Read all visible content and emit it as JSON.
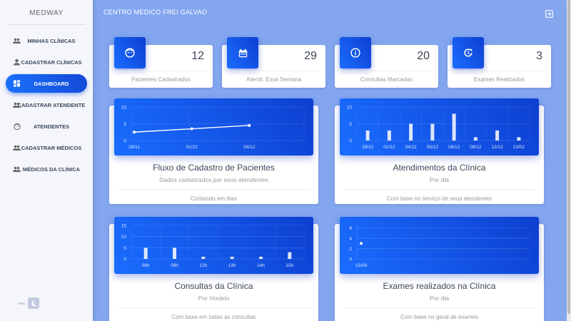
{
  "sidebar": {
    "brand": "MEDWAY",
    "items": [
      {
        "label": "MINHAS CLÍNICAS",
        "icon": "people-icon"
      },
      {
        "label": "CADASTRAR CLÍNICAS",
        "icon": "person-icon"
      },
      {
        "label": "DASHBOARD",
        "icon": "dashboard-icon",
        "active": true
      },
      {
        "label": "CADASTRAR ATENDENTE",
        "icon": "people-icon"
      },
      {
        "label": "ATENDENTES",
        "icon": "face-icon"
      },
      {
        "label": "CADASTRAR MÉDICOS",
        "icon": "people-icon"
      },
      {
        "label": "MÉDICOS DA CLÍNICA",
        "icon": "people-icon"
      }
    ]
  },
  "header": {
    "title": "CENTRO MEDICO FREI GALVAO",
    "logout_icon": "logout-icon"
  },
  "stats": [
    {
      "value": "12",
      "label": "Pacientes Cadastrados",
      "icon": "face-icon"
    },
    {
      "value": "29",
      "label": "Atendi. Essa Semana",
      "icon": "calendar-icon"
    },
    {
      "value": "20",
      "label": "Consultas Marcadas",
      "icon": "info-icon"
    },
    {
      "value": "3",
      "label": "Exames Realizados",
      "icon": "update-icon"
    }
  ],
  "cards": [
    {
      "title": "Fluxo de Cadastro de Pacientes",
      "subtitle": "Dados cadastrados por seus atendentes",
      "footer": "Contando em dias"
    },
    {
      "title": "Atendimentos da Clínica",
      "subtitle": "Por dia",
      "footer": "Com base no serviço de seus atendentes"
    },
    {
      "title": "Consultas da Clínica",
      "subtitle": "Por Horário",
      "footer": "Com base em todas as consultas"
    },
    {
      "title": "Exames realizados na Clínica",
      "subtitle": "Por dia",
      "footer": "Com base no geral de exames"
    }
  ],
  "colors": {
    "accent": "#1a6dff",
    "accent_dark": "#0d3fd0",
    "background": "#83a6ef"
  },
  "chart_data": [
    {
      "type": "line",
      "x": [
        "29/11",
        "01/12",
        "04/12"
      ],
      "values": [
        2.5,
        3.5,
        4.5
      ],
      "yticks": [
        0,
        5,
        10
      ],
      "ylim": [
        0,
        10
      ]
    },
    {
      "type": "bar",
      "categories": [
        "29/11",
        "01/12",
        "04/12",
        "05/12",
        "06/12",
        "08/12",
        "12/12",
        "13/02"
      ],
      "values": [
        3,
        3,
        5,
        5,
        8,
        1,
        3,
        1
      ],
      "yticks": [
        0,
        5,
        10
      ],
      "ylim": [
        0,
        10
      ]
    },
    {
      "type": "bar",
      "categories": [
        "08h",
        "09h",
        "12h",
        "13h",
        "14h",
        "15h"
      ],
      "values": [
        5,
        5,
        1,
        1,
        1,
        3
      ],
      "yticks": [
        0,
        5,
        10,
        15
      ],
      "ylim": [
        0,
        15
      ]
    },
    {
      "type": "scatter",
      "x": [
        "15/09"
      ],
      "values": [
        3
      ],
      "yticks": [
        0,
        2,
        4,
        6
      ],
      "ylim": [
        0,
        6.5
      ]
    }
  ]
}
